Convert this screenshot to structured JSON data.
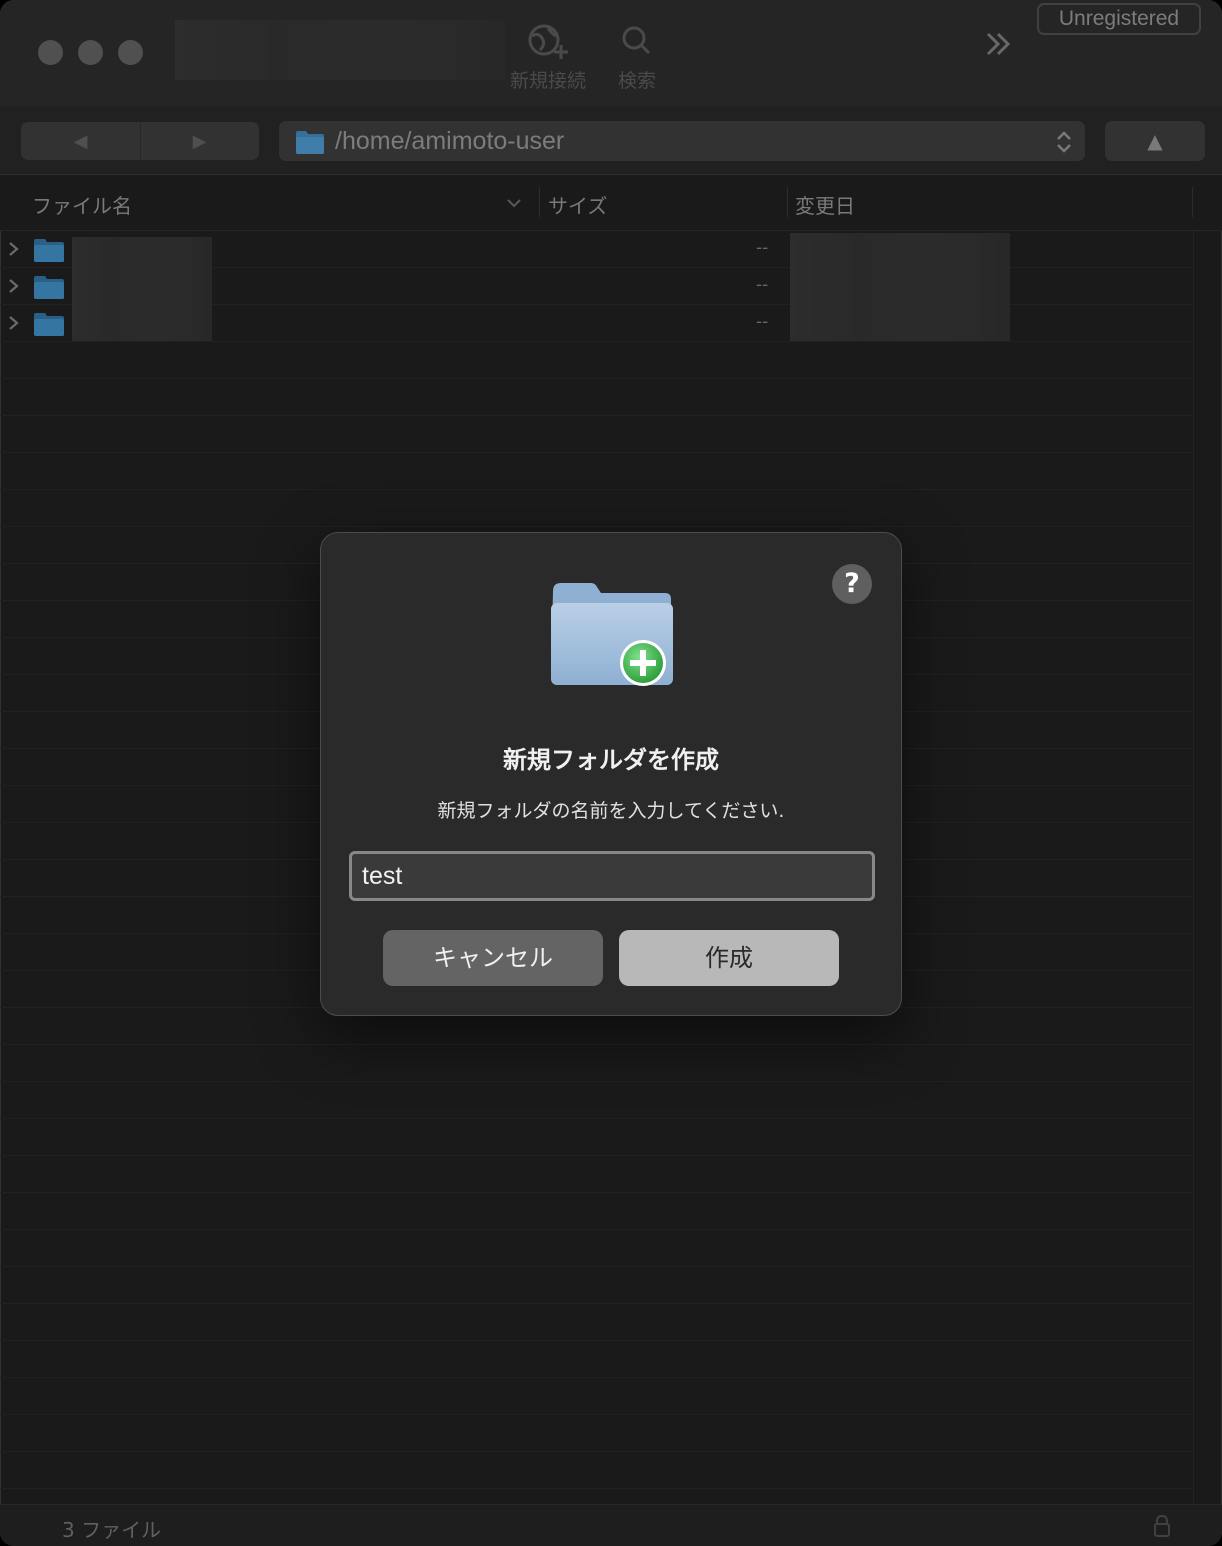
{
  "toolbar": {
    "new_connection_label": "新規接続",
    "search_label": "検索",
    "registration_badge": "Unregistered"
  },
  "nav": {
    "back_glyph": "◀",
    "forward_glyph": "▶",
    "current_path": "/home/amimoto-user",
    "up_glyph": "▲"
  },
  "columns": {
    "name": "ファイル名",
    "size": "サイズ",
    "modified": "変更日"
  },
  "rows": [
    {
      "size": "--",
      "icon": "folder-icon"
    },
    {
      "size": "--",
      "icon": "folder-icon"
    },
    {
      "size": "--",
      "icon": "folder-icon"
    }
  ],
  "status": {
    "file_count": "3 ファイル"
  },
  "dialog": {
    "help_glyph": "?",
    "title": "新規フォルダを作成",
    "message": "新規フォルダの名前を入力してください.",
    "input_value": "test",
    "cancel_label": "キャンセル",
    "create_label": "作成"
  },
  "colors": {
    "window_bg": "#1e1e1e",
    "folder_blue": "#4a8fc2",
    "dialog_bg": "#2a2a2a",
    "accent_green": "#3cb34a"
  }
}
